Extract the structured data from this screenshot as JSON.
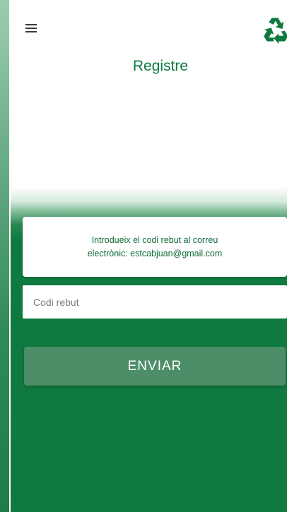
{
  "header": {
    "menu_icon": "hamburger-menu-icon",
    "logo_icon": "recycle-icon",
    "title": "Registre"
  },
  "info": {
    "message_line1": "Introdueix el codi rebut al correu",
    "message_line2": "electrònic:  estcabjuan@gmail.com"
  },
  "form": {
    "code_placeholder": "Codi rebut",
    "code_value": "",
    "submit_label": "ENVIAR"
  },
  "colors": {
    "brand_green": "#0f7a3f",
    "button_green": "#4d8e68",
    "title_green": "#0d7a40"
  }
}
